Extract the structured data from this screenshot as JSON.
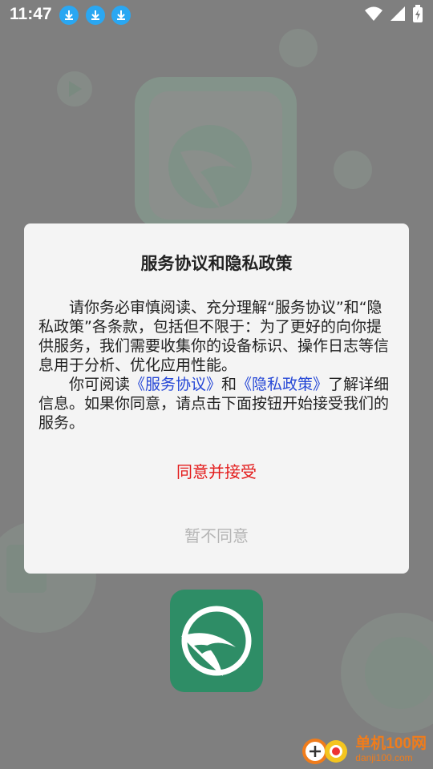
{
  "status_bar": {
    "time": "11:47",
    "notification_icons": [
      "download-icon",
      "download-icon",
      "download-icon"
    ],
    "system_icons": [
      "wifi-icon",
      "cell-signal-icon",
      "battery-charging-icon"
    ]
  },
  "dialog": {
    "title": "服务协议和隐私政策",
    "paragraph1": "请你务必审慎阅读、充分理解“服务协议”和“隐私政策”各条款，包括但不限于：为了更好的向你提供服务，我们需要收集你的设备标识、操作日志等信息用于分析、优化应用性能。",
    "p2_prefix": "你可阅读",
    "p2_link1": "《服务协议》",
    "p2_and": "和",
    "p2_link2": "《隐私政策》",
    "p2_suffix": "了解详细信息。如果你同意，请点击下面按钮开始接受我们的服务。",
    "accept_label": "同意并接受",
    "decline_label": "暂不同意"
  },
  "watermark": {
    "main": "单机100网",
    "sub": "danji100.com"
  },
  "colors": {
    "accept": "#e31b1b",
    "link": "#2547d6",
    "decline": "#b5b5b5",
    "brand_green": "#2e8d66",
    "download_badge": "#2aa7f2"
  }
}
